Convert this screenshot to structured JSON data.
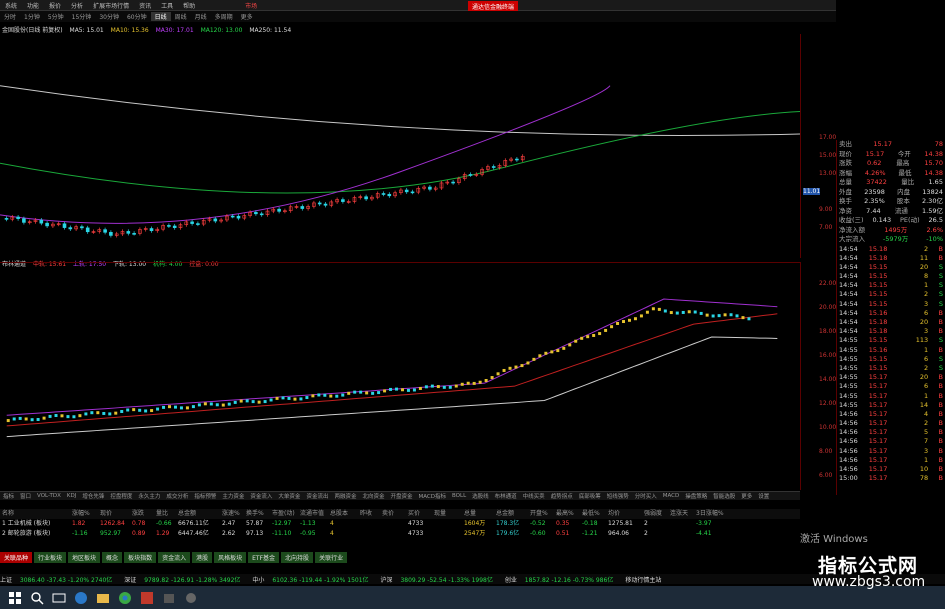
{
  "menu": {
    "items": [
      "系统",
      "功能",
      "报价",
      "分析",
      "扩展市场行情",
      "资讯",
      "工具",
      "帮助"
    ],
    "app_name": "市场",
    "hot_label": "通达信金融终端"
  },
  "periods": [
    "分时",
    "1分钟",
    "5分钟",
    "15分钟",
    "30分钟",
    "60分钟",
    "日线",
    "周线",
    "月线",
    "多周期",
    "更多"
  ],
  "active_period": "日线",
  "main_info": {
    "title": "金固股份(日线 前复权)",
    "ma5": "MA5: 15.01",
    "ma10": "MA10: 15.36",
    "ma30": "MA30: 17.01",
    "ma120": "MA120: 13.00",
    "ma250": "MA250: 11.54"
  },
  "sub_info": {
    "title": "布林通道",
    "mid": "中轨: 15.61",
    "upper": "上轨: 17.50",
    "lower": "下轨: 13.00",
    "lbl1": "机构: 4.00",
    "lbl2": "控盘: 0.00"
  },
  "axis_main": [
    "17.00",
    "15.00",
    "13.00",
    "11.01",
    "9.00",
    "7.00"
  ],
  "axis_sub": [
    "22.00",
    "20.00",
    "18.00",
    "16.00",
    "14.00",
    "12.00",
    "10.00",
    "8.00",
    "6.00"
  ],
  "quote": {
    "rows": [
      {
        "l": "卖出",
        "v": "15.17",
        "l2": "",
        "v2": "78"
      },
      {
        "l": "现价",
        "v": "15.17",
        "l2": "今开",
        "v2": "14.38"
      },
      {
        "l": "涨跌",
        "v": "0.62",
        "l2": "最高",
        "v2": "15.70"
      },
      {
        "l": "涨幅",
        "v": "4.26%",
        "l2": "最低",
        "v2": "14.38"
      },
      {
        "l": "总量",
        "v": "37422",
        "l2": "量比",
        "v2": "1.65"
      },
      {
        "l": "外盘",
        "v": "23598",
        "l2": "内盘",
        "v2": "13824"
      },
      {
        "l": "换手",
        "v": "2.35%",
        "l2": "股本",
        "v2": "2.30亿"
      },
      {
        "l": "净资",
        "v": "7.44",
        "l2": "流通",
        "v2": "1.59亿"
      },
      {
        "l": "收益(三)",
        "v": "0.143",
        "l2": "PE(动)",
        "v2": "26.5"
      }
    ],
    "flow1": {
      "l": "净流入额",
      "v": "1495万",
      "p": "2.6%"
    },
    "flow2": {
      "l": "大宗流入",
      "v": "-5979万",
      "p": "-10%"
    }
  },
  "ticks": [
    [
      "14:54",
      "15.18",
      "2",
      "B"
    ],
    [
      "14:54",
      "15.18",
      "11",
      "B"
    ],
    [
      "14:54",
      "15.15",
      "20",
      "S"
    ],
    [
      "14:54",
      "15.15",
      "8",
      "S"
    ],
    [
      "14:54",
      "15.15",
      "1",
      "S"
    ],
    [
      "14:54",
      "15.15",
      "2",
      "S"
    ],
    [
      "14:54",
      "15.15",
      "3",
      "S"
    ],
    [
      "14:54",
      "15.16",
      "6",
      "B"
    ],
    [
      "14:54",
      "15.18",
      "20",
      "B"
    ],
    [
      "14:54",
      "15.18",
      "3",
      "B"
    ],
    [
      "14:55",
      "15.15",
      "113",
      "S"
    ],
    [
      "14:55",
      "15.16",
      "1",
      "B"
    ],
    [
      "14:55",
      "15.15",
      "6",
      "S"
    ],
    [
      "14:55",
      "15.15",
      "2",
      "S"
    ],
    [
      "14:55",
      "15.17",
      "20",
      "B"
    ],
    [
      "14:55",
      "15.17",
      "6",
      "B"
    ],
    [
      "14:55",
      "15.17",
      "1",
      "B"
    ],
    [
      "14:55",
      "15.17",
      "14",
      "B"
    ],
    [
      "14:56",
      "15.17",
      "4",
      "B"
    ],
    [
      "14:56",
      "15.17",
      "2",
      "B"
    ],
    [
      "14:56",
      "15.17",
      "5",
      "B"
    ],
    [
      "14:56",
      "15.17",
      "7",
      "B"
    ],
    [
      "14:56",
      "15.17",
      "3",
      "B"
    ],
    [
      "14:56",
      "15.17",
      "1",
      "B"
    ],
    [
      "14:56",
      "15.17",
      "10",
      "B"
    ],
    [
      "15:00",
      "15.17",
      "78",
      "B"
    ]
  ],
  "bottom_tabs": [
    "指标",
    "窗口",
    "VOL-TDX",
    "KDJ",
    "增仓先锋",
    "控盘程度",
    "永久主力",
    "成交分析",
    "指标预警",
    "主力资金",
    "资金流入",
    "大单资金",
    "资金流出",
    "两融资金",
    "北向资金",
    "开盘资金",
    "MACD指标",
    "BOLL",
    "选股线",
    "布林通道",
    "中线买卖",
    "趋势拐点",
    "底部吸筹",
    "短线强势",
    "分时买入",
    "MACD",
    "操盘策略",
    "智能选股",
    "更多",
    "设置"
  ],
  "table": {
    "headers": [
      "名称",
      "涨幅%",
      "现价",
      "涨跌",
      "量比",
      "总金额",
      "涨速%",
      "换手%",
      "市盈(动)",
      "流通市值",
      "总股本",
      "昨收",
      "卖价",
      "买价",
      "现量",
      "总量",
      "总金额",
      "开盘%",
      "最高%",
      "最低%",
      "均价",
      "强弱度",
      "连涨天",
      "3日涨幅%"
    ],
    "rows": [
      {
        "idx": "1",
        "name": "工业机械",
        "tag": "(板块)",
        "pct": "1.82",
        "price": "1262.84",
        "chg": "0.78",
        "vr": "-0.66",
        "amt": "6676.11亿",
        "spd": "2.47",
        "turn": "57.87",
        "pe": "-12.97",
        "b": "-1.13",
        "c": "4",
        "d": "4733",
        "vol": "1604万",
        "am2": "178.3亿",
        "op": "-0.52",
        "hi": "0.35",
        "lo": "-0.18",
        "avg": "1275.81",
        "str": "2",
        "days": "-3.97"
      },
      {
        "idx": "2",
        "name": "邮轮旅游",
        "tag": "(板块)",
        "pct": "-1.16",
        "price": "952.97",
        "chg": "0.89",
        "vr": "1.29",
        "amt": "6447.46亿",
        "spd": "2.62",
        "turn": "97.13",
        "pe": "-11.10",
        "b": "-0.95",
        "c": "4",
        "d": "4733",
        "vol": "2547万",
        "am2": "179.6亿",
        "op": "-0.60",
        "hi": "0.51",
        "lo": "-1.21",
        "avg": "964.06",
        "str": "2",
        "days": "-4.41"
      }
    ]
  },
  "sectors": [
    "关联品种",
    "行业板块",
    "地区板块",
    "概念",
    "板块指数",
    "资金流入",
    "港股",
    "风格板块",
    "ETF基金",
    "北向持股",
    "关联行业"
  ],
  "indexes": [
    {
      "name": "上证",
      "val": "3086.40 -37.43 -1.20% 2740亿",
      "c": "grn"
    },
    {
      "name": "深证",
      "val": "9789.82 -126.91 -1.28% 3492亿",
      "c": "grn"
    },
    {
      "name": "中小",
      "val": "6102.36 -119.44 -1.92% 1501亿",
      "c": "grn"
    },
    {
      "name": "沪深",
      "val": "3809.29 -52.54 -1.33% 1998亿",
      "c": "grn"
    },
    {
      "name": "创业",
      "val": "1857.82 -12.16 -0.73% 986亿",
      "c": "grn"
    }
  ],
  "status_tail": "移动行情主站",
  "activate_text": "激活 Windows",
  "watermark": {
    "line1": "指标公式网",
    "line2": "www.zbgs3.com"
  },
  "colors": {
    "up": "#ff4040",
    "down": "#26d64a",
    "accent": "#c00000"
  }
}
